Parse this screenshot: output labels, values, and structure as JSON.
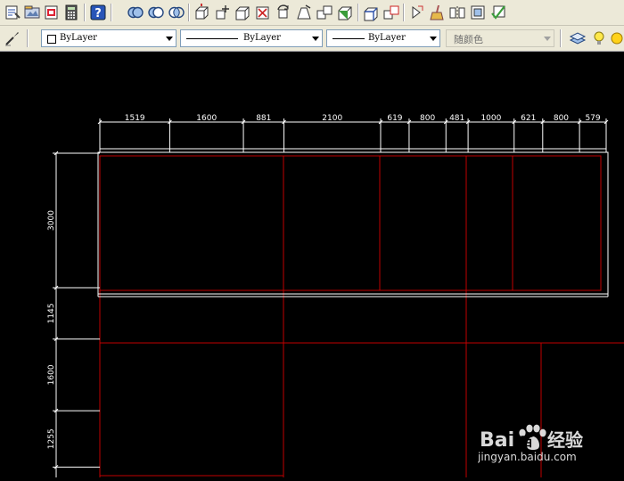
{
  "combos": {
    "color": "ByLayer",
    "linetype": "ByLayer",
    "lineweight": "ByLayer",
    "plotstyle": "随颜色"
  },
  "drawing": {
    "top_dims": [
      "1519",
      "1600",
      "881",
      "2100",
      "619",
      "800",
      "481",
      "1000",
      "621",
      "800",
      "579"
    ],
    "left_dims": [
      "3000",
      "1145",
      "1600",
      "1255"
    ]
  },
  "watermark": {
    "brand": "Bai",
    "brand_end": "百",
    "cn": "经验",
    "url": "jingyan.baidu.com"
  },
  "colors": {
    "canvas": "#000000",
    "wall_line": "#c00000",
    "dim_line": "#ffffff",
    "toolbar_bg": "#ece9d8"
  }
}
